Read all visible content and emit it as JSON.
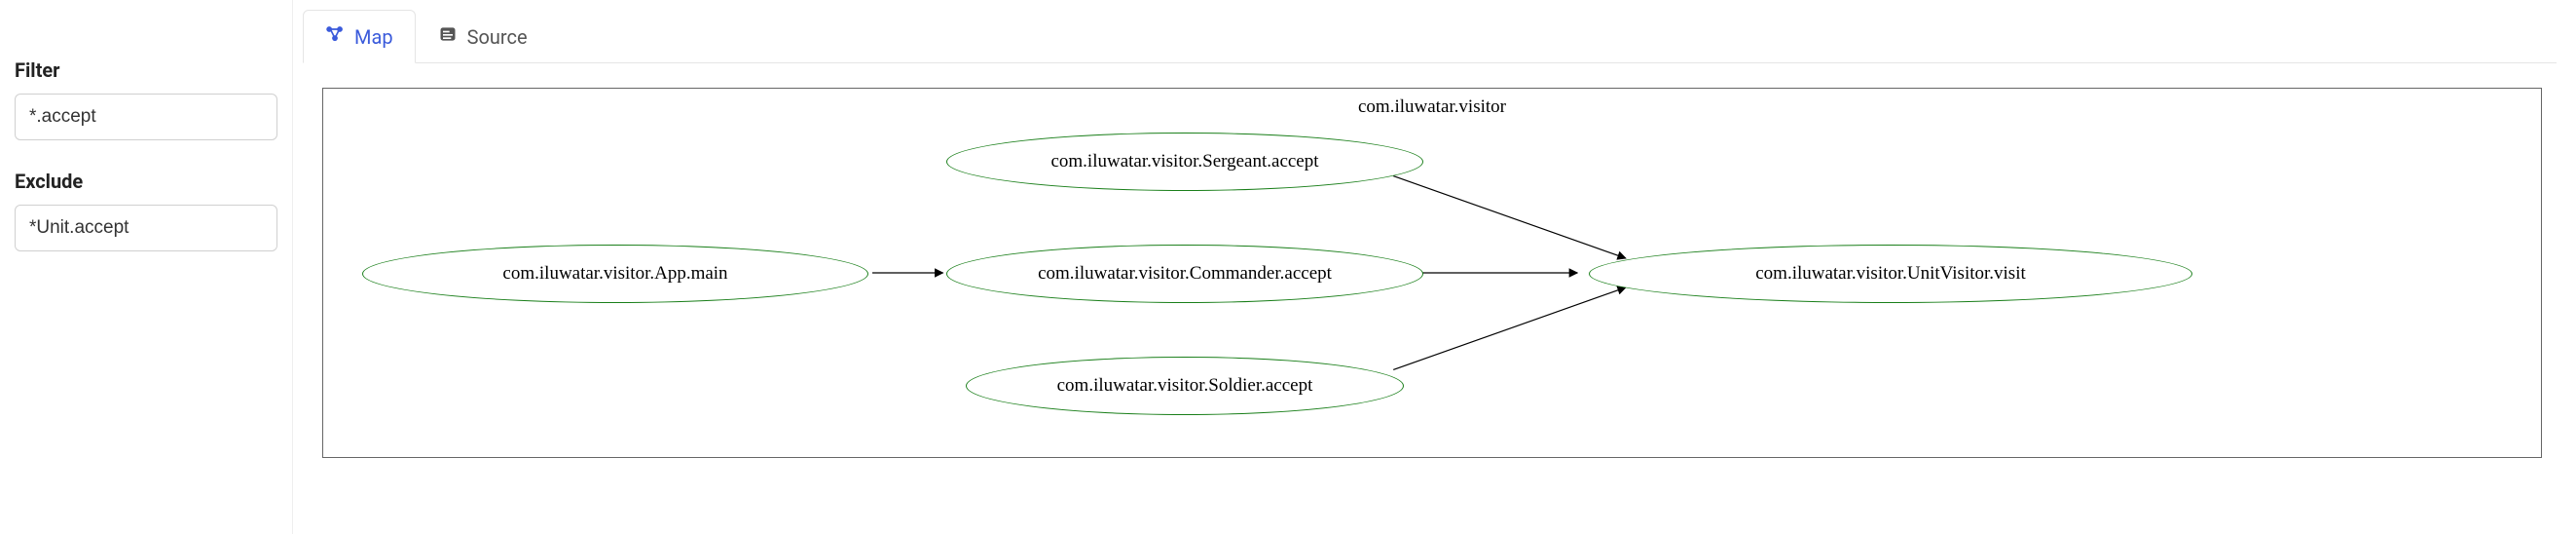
{
  "sidebar": {
    "filter_label": "Filter",
    "filter_value": "*.accept",
    "exclude_label": "Exclude",
    "exclude_value": "*Unit.accept"
  },
  "tabs": {
    "map_label": "Map",
    "source_label": "Source"
  },
  "diagram": {
    "package_title": "com.iluwatar.visitor",
    "nodes": {
      "app_main": "com.iluwatar.visitor.App.main",
      "sergeant": "com.iluwatar.visitor.Sergeant.accept",
      "commander": "com.iluwatar.visitor.Commander.accept",
      "soldier": "com.iluwatar.visitor.Soldier.accept",
      "unitvisitor": "com.iluwatar.visitor.UnitVisitor.visit"
    }
  }
}
